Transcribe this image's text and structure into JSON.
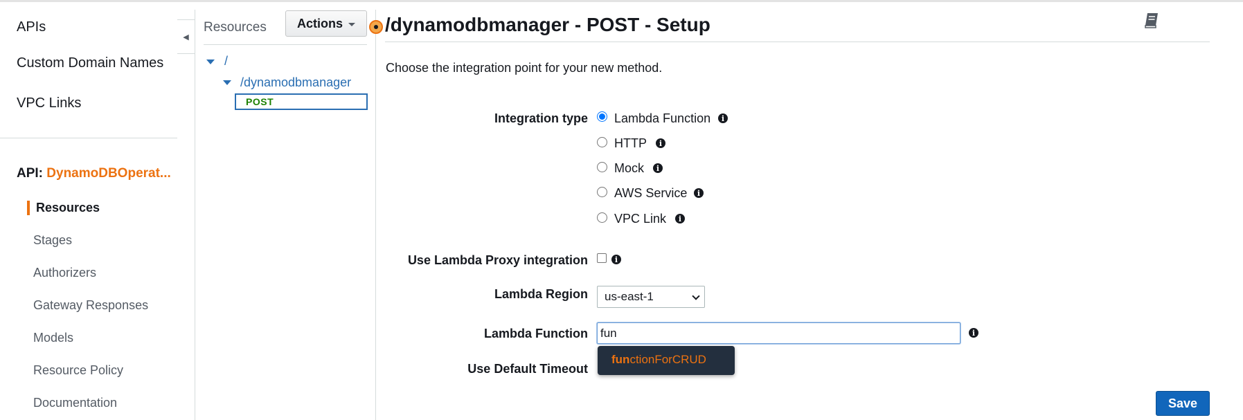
{
  "left_nav": {
    "top_items": [
      "APIs",
      "Custom Domain Names",
      "VPC Links"
    ],
    "api_prefix": "API:",
    "api_name": "DynamoDBOperat...",
    "sub_items": [
      "Resources",
      "Stages",
      "Authorizers",
      "Gateway Responses",
      "Models",
      "Resource Policy",
      "Documentation"
    ],
    "active_item": "Resources"
  },
  "resources_panel": {
    "title": "Resources",
    "actions_label": "Actions",
    "tree": {
      "root": "/",
      "child": "/dynamodbmanager",
      "method": "POST"
    }
  },
  "main": {
    "title": "/dynamodbmanager - POST - Setup",
    "intro": "Choose the integration point for your new method.",
    "integration_type_label": "Integration type",
    "integration_options": [
      "Lambda Function",
      "HTTP",
      "Mock",
      "AWS Service",
      "VPC Link"
    ],
    "selected_integration": "Lambda Function",
    "proxy_label": "Use Lambda Proxy integration",
    "proxy_checked": false,
    "region_label": "Lambda Region",
    "region_value": "us-east-1",
    "function_label": "Lambda Function",
    "function_value": "fun",
    "suggestion_match": "fun",
    "suggestion_rest": "ctionForCRUD",
    "timeout_label": "Use Default Timeout",
    "save_label": "Save"
  },
  "colors": {
    "accent_orange": "#ec7211",
    "link_blue": "#2a6eb2",
    "save_blue": "#1166bb",
    "dropdown_bg": "#232f3e",
    "post_green": "#1d8102"
  },
  "icons": {
    "collapse": "chevron-left-icon",
    "info": "info-icon",
    "book": "book-icon"
  }
}
